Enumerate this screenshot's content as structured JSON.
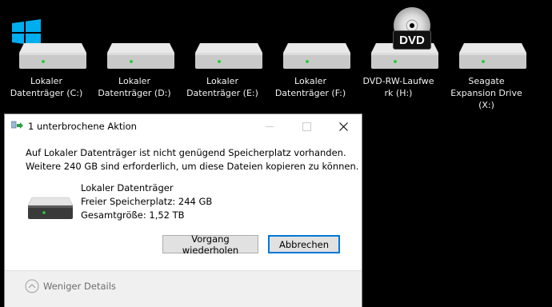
{
  "drives": [
    {
      "label": "Lokaler\nDatenträger (C:)",
      "icon": "hard-drive-icon"
    },
    {
      "label": "Lokaler\nDatenträger (D:)",
      "icon": "hard-drive-icon"
    },
    {
      "label": "Lokaler\nDatenträger (E:)",
      "icon": "hard-drive-icon"
    },
    {
      "label": "Lokaler\nDatenträger  (F:)",
      "icon": "hard-drive-icon"
    },
    {
      "label": "DVD-RW-Laufwe\nrk (H:)",
      "icon": "dvd-drive-icon",
      "badge": "DVD"
    },
    {
      "label": "Seagate\nExpansion Drive\n(X:)",
      "icon": "hard-drive-icon"
    }
  ],
  "dialog": {
    "title": "1 unterbrochene Aktion",
    "message_line1": "Auf Lokaler Datenträger ist nicht genügend Speicherplatz vorhanden.",
    "message_line2": "Weitere 240 GB sind erforderlich, um diese Dateien kopieren zu können.",
    "drive_name": "Lokaler Datenträger",
    "free_space": "Freier Speicherplatz: 244 GB",
    "total_size": "Gesamtgröße: 1,52 TB",
    "retry_button": "Vorgang wiederholen",
    "cancel_button": "Abbrechen",
    "details_toggle": "Weniger Details"
  },
  "colors": {
    "windows_blue": "#00adef",
    "accent": "#0078d7",
    "drive_led": "#2ecc40"
  }
}
